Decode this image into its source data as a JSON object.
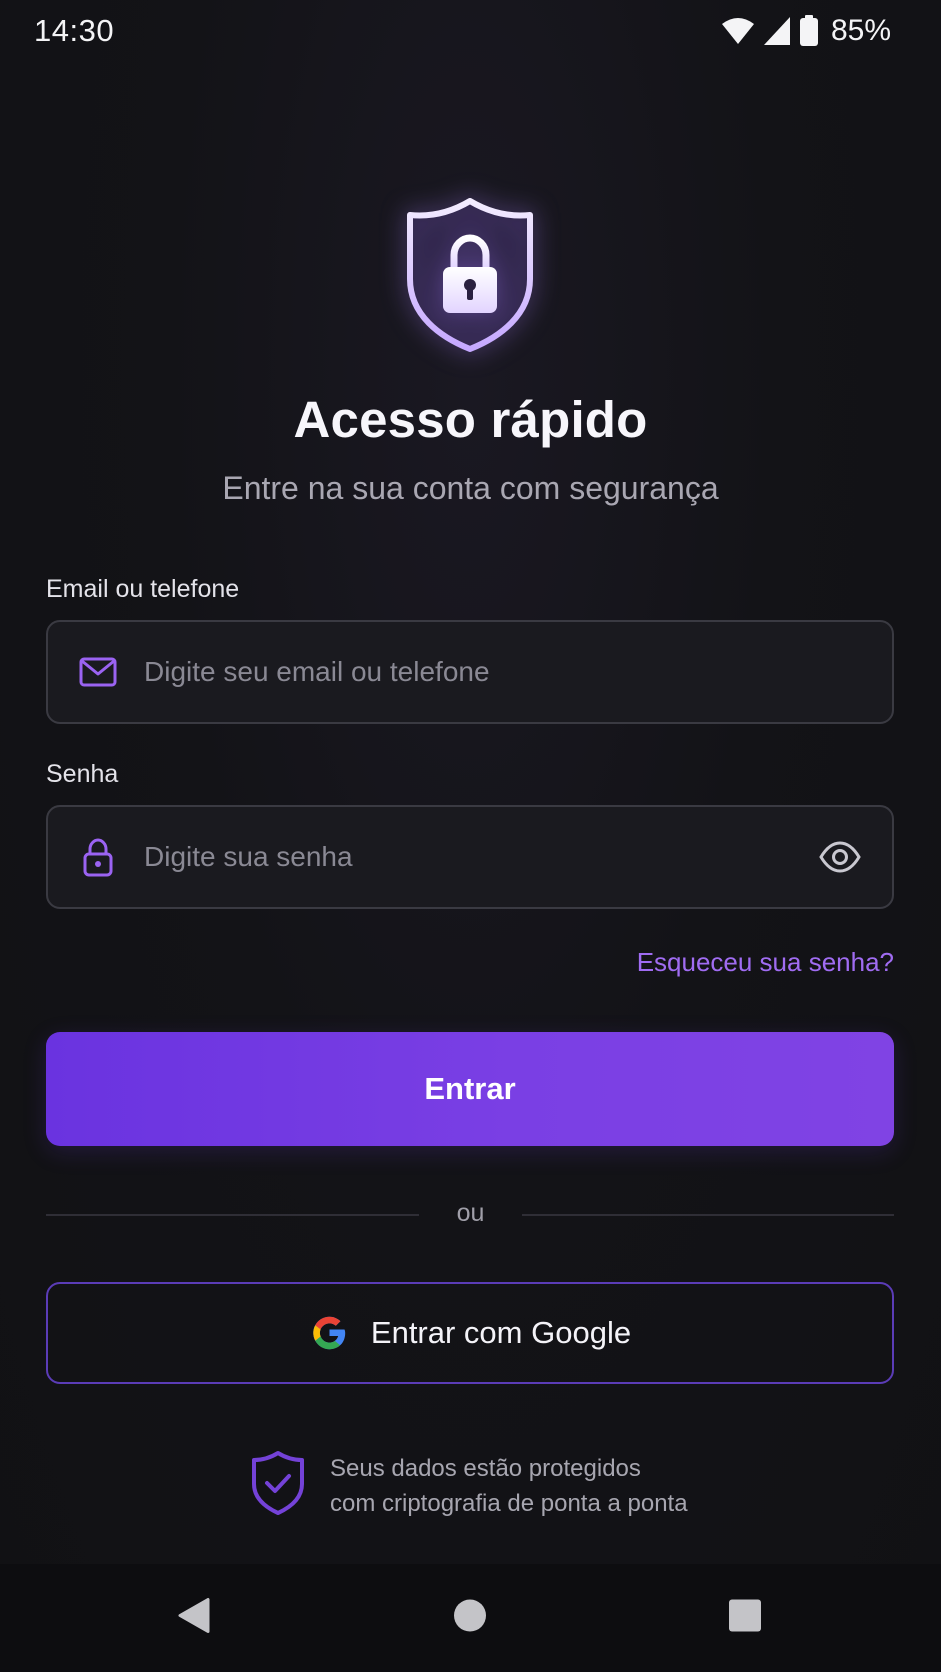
{
  "status_bar": {
    "time": "14:30",
    "battery": "85%",
    "icons": [
      "wifi-icon",
      "cellular-signal-icon",
      "battery-icon"
    ]
  },
  "header": {
    "icon": "shield-lock-icon",
    "title": "Acesso rápido",
    "subtitle": "Entre na sua conta com segurança"
  },
  "form": {
    "email": {
      "label": "Email ou telefone",
      "placeholder": "Digite seu email ou telefone",
      "value": "",
      "icon": "mail-icon"
    },
    "password": {
      "label": "Senha",
      "placeholder": "Digite sua senha",
      "value": "",
      "icon": "lock-icon",
      "toggle_icon": "eye-icon"
    },
    "forgot_password": "Esqueceu sua senha?",
    "submit_label": "Entrar"
  },
  "divider": {
    "text": "ou"
  },
  "social": {
    "google_label": "Entrar com Google",
    "icon": "google-icon"
  },
  "security_note": {
    "icon": "shield-check-icon",
    "line1": "Seus dados estão protegidos",
    "line2": "com criptografia de ponta a ponta"
  },
  "nav_bar": {
    "buttons": [
      "back-icon",
      "home-icon",
      "recents-icon"
    ]
  },
  "colors": {
    "background": "#121216",
    "accent": "#7a3fe4",
    "accent_text": "#a06cf2",
    "input_border": "#3a3a42",
    "google_border": "#5b3cb7",
    "muted_text": "#a9a7b2"
  }
}
